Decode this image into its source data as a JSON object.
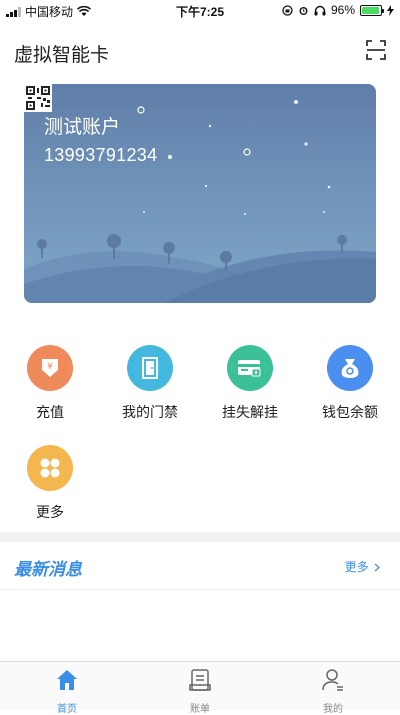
{
  "status_bar": {
    "carrier": "中国移动",
    "time": "下午7:25",
    "battery": "96%",
    "battery_level": 0.96
  },
  "header": {
    "title": "虚拟智能卡",
    "scan_icon": "scan-icon"
  },
  "card": {
    "account_name": "测试账户",
    "phone": "13993791234",
    "qr_icon": "qrcode-icon"
  },
  "functions": [
    {
      "label": "充值",
      "icon": "recharge-icon",
      "color": "#ef8a5a"
    },
    {
      "label": "我的门禁",
      "icon": "door-icon",
      "color": "#45b8e0"
    },
    {
      "label": "挂失解挂",
      "icon": "card-lock-icon",
      "color": "#3cc09a"
    },
    {
      "label": "钱包余额",
      "icon": "wallet-icon",
      "color": "#4a8ef0"
    },
    {
      "label": "更多",
      "icon": "more-grid-icon",
      "color": "#f4b64f"
    }
  ],
  "news": {
    "title": "最新消息",
    "more": "更多"
  },
  "tabbar": {
    "items": [
      {
        "label": "首页",
        "icon": "home-icon",
        "active": true
      },
      {
        "label": "账单",
        "icon": "bill-icon",
        "active": false
      },
      {
        "label": "我的",
        "icon": "profile-icon",
        "active": false
      }
    ],
    "accent": "#3a8ee6"
  }
}
